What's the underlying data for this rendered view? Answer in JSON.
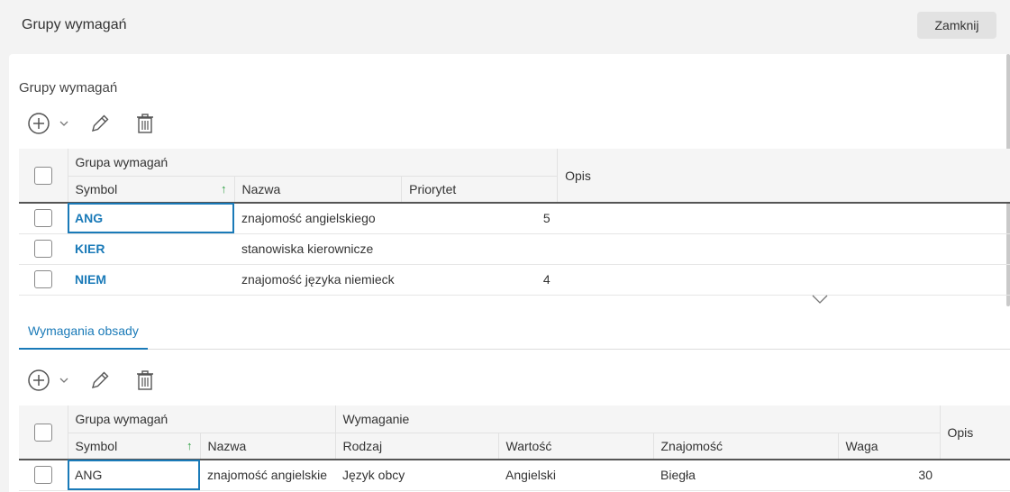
{
  "dialog": {
    "title": "Grupy wymagań",
    "close_label": "Zamknij"
  },
  "groups_section": {
    "title": "Grupy wymagań",
    "toolbar": {
      "add_icon": "plus-circle-icon",
      "dropdown_icon": "chevron-down-icon",
      "edit_icon": "pencil-icon",
      "delete_icon": "trash-icon"
    },
    "header": {
      "group_label": "Grupa wymagań",
      "col_symbol": "Symbol",
      "col_nazwa": "Nazwa",
      "col_priorytet": "Priorytet",
      "col_opis": "Opis",
      "sort_indicator": "↑"
    },
    "rows": [
      {
        "symbol": "ANG",
        "nazwa": "znajomość angielskiego",
        "priorytet": "5",
        "opis": ""
      },
      {
        "symbol": "KIER",
        "nazwa": "stanowiska kierownicze",
        "priorytet": "",
        "opis": ""
      },
      {
        "symbol": "NIEM",
        "nazwa": "znajomość języka niemieck",
        "priorytet": "4",
        "opis": ""
      }
    ]
  },
  "tabs": {
    "active_label": "Wymagania obsady"
  },
  "requirements_section": {
    "toolbar": {
      "add_icon": "plus-circle-icon",
      "dropdown_icon": "chevron-down-icon",
      "edit_icon": "pencil-icon",
      "delete_icon": "trash-icon"
    },
    "header": {
      "group_label": "Grupa wymagań",
      "req_label": "Wymaganie",
      "col_symbol": "Symbol",
      "col_nazwa": "Nazwa",
      "col_rodzaj": "Rodzaj",
      "col_wartosc": "Wartość",
      "col_znajomosc": "Znajomość",
      "col_waga": "Waga",
      "col_opis": "Opis",
      "sort_indicator": "↑"
    },
    "rows": [
      {
        "symbol": "ANG",
        "nazwa": "znajomość angielskie",
        "rodzaj": "Język obcy",
        "wartosc": "Angielski",
        "znajomosc": "Biegła",
        "waga": "30",
        "opis": ""
      }
    ]
  },
  "colors": {
    "accent": "#1a7ab8",
    "sort_arrow": "#2ea043",
    "background": "#f3f3f3"
  }
}
